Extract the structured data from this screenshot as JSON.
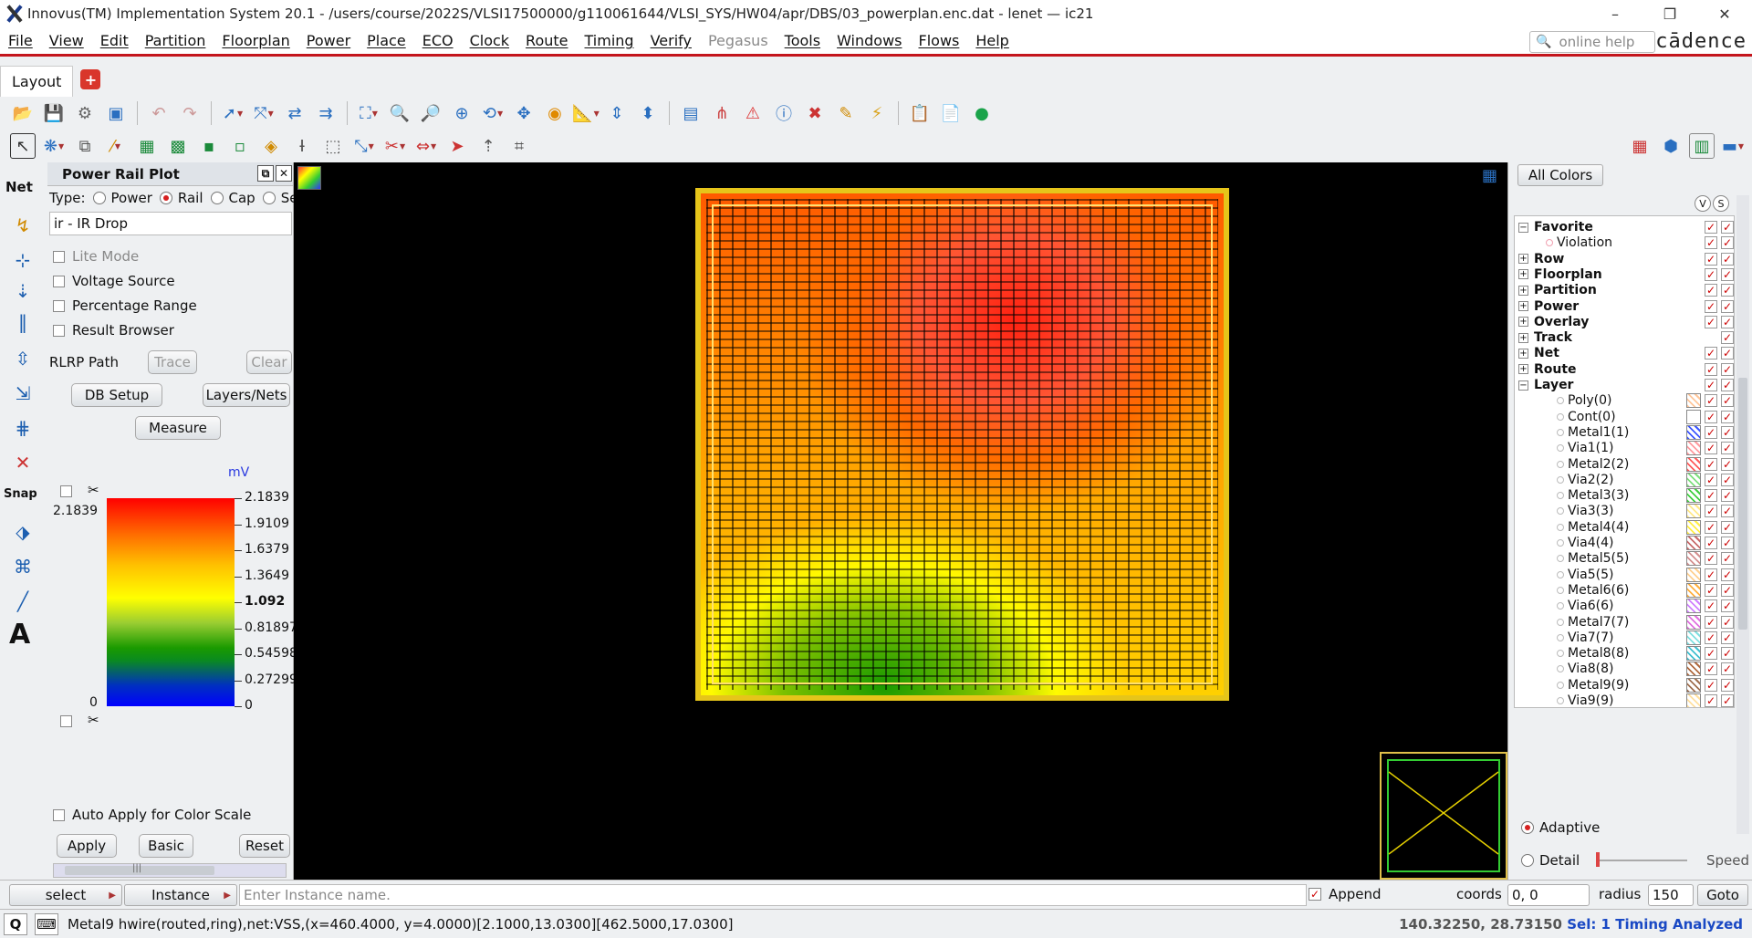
{
  "title": "Innovus(TM) Implementation System 20.1 - /users/course/2022S/VLSI17500000/g110061644/VLSI_SYS/HW04/apr/DBS/03_powerplan.enc.dat - lenet — ic21",
  "window_buttons": {
    "minimize": "–",
    "restore": "❐",
    "close": "✕"
  },
  "menu": [
    "File",
    "View",
    "Edit",
    "Partition",
    "Floorplan",
    "Power",
    "Place",
    "ECO",
    "Clock",
    "Route",
    "Timing",
    "Verify",
    "Pegasus",
    "Tools",
    "Windows",
    "Flows",
    "Help"
  ],
  "menu_disabled": "Pegasus",
  "help_placeholder": "online help",
  "brand": "cādence",
  "tab": "Layout",
  "tab_add": "+",
  "left_toolbar": {
    "net_label": "Net",
    "snap_label": "Snap",
    "text_tool": "A"
  },
  "panel": {
    "title": "Power Rail Plot",
    "float_btn": "⧉",
    "close_btn": "✕",
    "type_label": "Type:",
    "types": [
      "Power",
      "Rail",
      "Cap",
      "Se"
    ],
    "selected_type": "Rail",
    "analysis": "ir - IR Drop",
    "checks": [
      "Lite Mode",
      "Voltage Source",
      "Percentage Range",
      "Result Browser"
    ],
    "rlrp_label": "RLRP Path",
    "trace": "Trace",
    "clear": "Clear",
    "db_setup": "DB Setup",
    "layers_nets": "Layers/Nets",
    "measure": "Measure",
    "unit": "mV",
    "max_value": "2.1839",
    "min_value": "0",
    "scale": [
      "2.1839",
      "1.9109",
      "1.6379",
      "1.3649",
      "1.092",
      "0.81897",
      "0.54598",
      "0.27299",
      "0"
    ],
    "auto_apply": "Auto Apply for Color Scale",
    "apply": "Apply",
    "basic": "Basic",
    "reset": "Reset",
    "scroll_grip": "|||"
  },
  "colors_panel": {
    "all_colors": "All Colors",
    "v": "V",
    "s": "S",
    "tree": [
      {
        "label": "Favorite",
        "bold": true,
        "pm": "−"
      },
      {
        "label": "Violation",
        "bold": false,
        "indent": 2,
        "dot": "#f0a0b0"
      },
      {
        "label": "Row",
        "bold": true,
        "pm": "+"
      },
      {
        "label": "Floorplan",
        "bold": true,
        "pm": "+"
      },
      {
        "label": "Partition",
        "bold": true,
        "pm": "+"
      },
      {
        "label": "Power",
        "bold": true,
        "pm": "+"
      },
      {
        "label": "Overlay",
        "bold": true,
        "pm": "+"
      },
      {
        "label": "Track",
        "bold": true,
        "pm": "+"
      },
      {
        "label": "Net",
        "bold": true,
        "pm": "+"
      },
      {
        "label": "Route",
        "bold": true,
        "pm": "+"
      },
      {
        "label": "Layer",
        "bold": true,
        "pm": "−"
      },
      {
        "label": "Poly(0)",
        "indent": 3,
        "sw": "#ffc69a"
      },
      {
        "label": "Cont(0)",
        "indent": 3,
        "sw": "#ffffff"
      },
      {
        "label": "Metal1(1)",
        "indent": 3,
        "sw": "#3b55ff"
      },
      {
        "label": "Via1(1)",
        "indent": 3,
        "sw": "#ff9aa0"
      },
      {
        "label": "Metal2(2)",
        "indent": 3,
        "sw": "#ff5a5a"
      },
      {
        "label": "Via2(2)",
        "indent": 3,
        "sw": "#7ee07e"
      },
      {
        "label": "Metal3(3)",
        "indent": 3,
        "sw": "#3fcf3f"
      },
      {
        "label": "Via3(3)",
        "indent": 3,
        "sw": "#ffe98a"
      },
      {
        "label": "Metal4(4)",
        "indent": 3,
        "sw": "#ffee44"
      },
      {
        "label": "Via4(4)",
        "indent": 3,
        "sw": "#c86a6a"
      },
      {
        "label": "Metal5(5)",
        "indent": 3,
        "sw": "#d49090"
      },
      {
        "label": "Via5(5)",
        "indent": 3,
        "sw": "#ffd090"
      },
      {
        "label": "Metal6(6)",
        "indent": 3,
        "sw": "#ffb040"
      },
      {
        "label": "Via6(6)",
        "indent": 3,
        "sw": "#d080ff"
      },
      {
        "label": "Metal7(7)",
        "indent": 3,
        "sw": "#e070e0"
      },
      {
        "label": "Via7(7)",
        "indent": 3,
        "sw": "#80e0e0"
      },
      {
        "label": "Metal8(8)",
        "indent": 3,
        "sw": "#40c0d0"
      },
      {
        "label": "Via8(8)",
        "indent": 3,
        "sw": "#b06a40"
      },
      {
        "label": "Metal9(9)",
        "indent": 3,
        "sw": "#a07050"
      },
      {
        "label": "Via9(9)",
        "indent": 3,
        "sw": "#ffe0a0"
      }
    ],
    "adaptive": "Adaptive",
    "detail": "Detail",
    "speed": "Speed"
  },
  "bottom": {
    "select": "select",
    "instance": "Instance",
    "entry_placeholder": "Enter Instance name.",
    "append": "Append",
    "coords_label": "coords",
    "coords_value": "0, 0",
    "radius_label": "radius",
    "radius_value": "150",
    "goto": "Goto"
  },
  "status": {
    "q": "Q",
    "message": "Metal9 hwire(routed,ring),net:VSS,(x=460.4000, y=4.0000)[2.1000,13.0300][462.5000,17.0300]",
    "coords": "140.32250, 28.73150",
    "sel": "Sel: 1",
    "timing": "Timing Analyzed"
  },
  "colors": {
    "accent_red": "#c4151c",
    "ir_high": "#ff0000",
    "ir_low": "#0000ff",
    "die_ring": "#e6c51a"
  }
}
